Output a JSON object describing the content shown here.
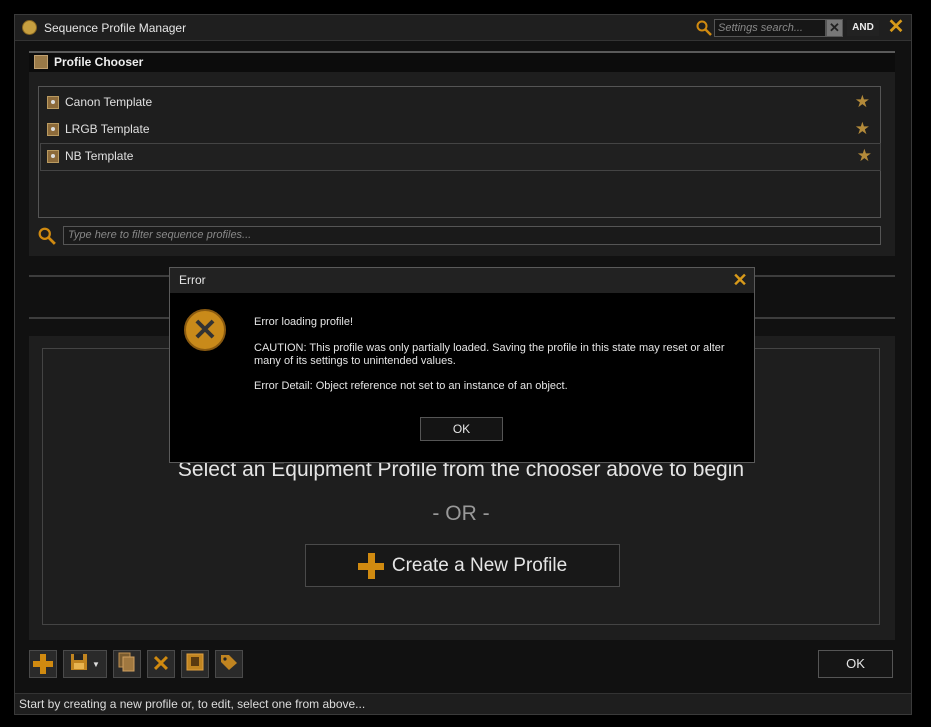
{
  "window": {
    "title": "Sequence Profile Manager",
    "settings_search_placeholder": "Settings search...",
    "and_label": "AND"
  },
  "chooser": {
    "title": "Profile Chooser",
    "profiles": [
      {
        "label": "Canon Template"
      },
      {
        "label": "LRGB Template"
      },
      {
        "label": "NB Template"
      }
    ],
    "filter_placeholder": "Type here to filter sequence profiles..."
  },
  "main": {
    "instruction": "Select an Equipment Profile from the chooser above to begin",
    "or_text": "- OR -",
    "create_label": "Create a New Profile"
  },
  "footer": {
    "ok_label": "OK",
    "status_text": "Start by creating a new profile or, to edit, select one from above..."
  },
  "dialog": {
    "title": "Error",
    "heading": "Error loading profile!",
    "caution": "CAUTION: This profile was only partially loaded. Saving the profile in this state may reset or alter many of its settings to unintended values.",
    "detail": "Error Detail: Object reference not set to an instance of an object.",
    "ok_label": "OK"
  },
  "colors": {
    "accent": "#d89a1a",
    "background": "#000000",
    "panel": "#1e1e1e"
  },
  "icons": [
    "app-icon",
    "search-icon",
    "clear-icon",
    "close-icon",
    "profile-icon",
    "star-icon",
    "add-icon",
    "save-icon",
    "copy-icon",
    "delete-icon",
    "import-icon",
    "tag-icon",
    "error-icon"
  ]
}
